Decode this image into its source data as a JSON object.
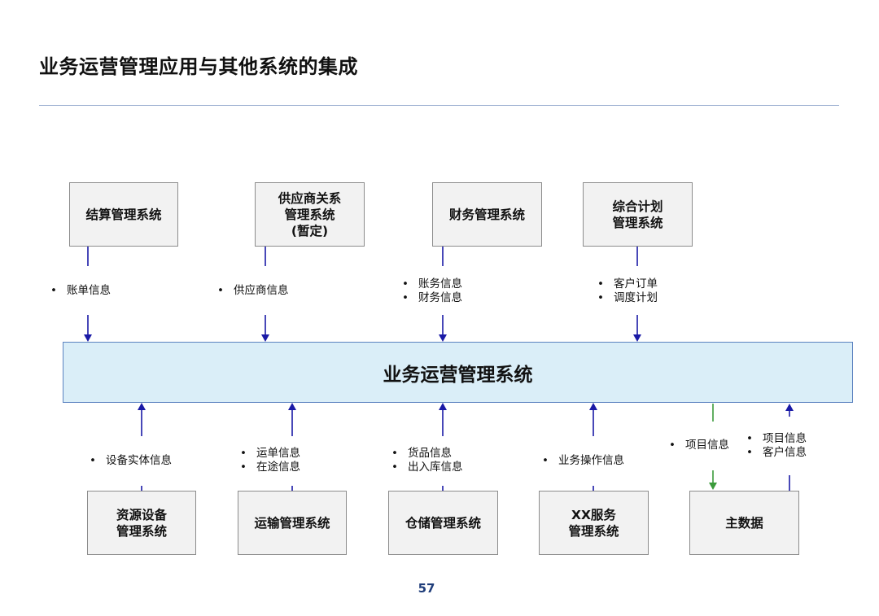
{
  "page": {
    "title": "业务运营管理应用与其他系统的集成",
    "page_number": "57"
  },
  "central_system": {
    "label": "业务运营管理系统"
  },
  "top_systems": [
    {
      "label": "结算管理系统",
      "flows": [
        "账单信息"
      ]
    },
    {
      "label": "供应商关系\n管理系统\n(暂定)",
      "flows": [
        "供应商信息"
      ]
    },
    {
      "label": "财务管理系统",
      "flows": [
        "账务信息",
        "财务信息"
      ]
    },
    {
      "label": "综合计划\n管理系统",
      "flows": [
        "客户订单",
        "调度计划"
      ]
    }
  ],
  "bottom_systems": [
    {
      "label": "资源设备\n管理系统",
      "flows": [
        "设备实体信息"
      ]
    },
    {
      "label": "运输管理系统",
      "flows": [
        "运单信息",
        "在途信息"
      ]
    },
    {
      "label": "仓储管理系统",
      "flows": [
        "货品信息",
        "出入库信息"
      ]
    },
    {
      "label": "XX服务\n管理系统",
      "flows": [
        "业务操作信息"
      ]
    },
    {
      "label": "主数据",
      "flows_down": [
        "项目信息"
      ],
      "flows_up": [
        "项目信息",
        "客户信息"
      ]
    }
  ],
  "colors": {
    "arrow_blue": "#1a1aa6",
    "arrow_green": "#3a9a3a",
    "box_fill": "#f2f2f2",
    "central_fill": "#daeef8",
    "rule": "#9aaed0"
  }
}
